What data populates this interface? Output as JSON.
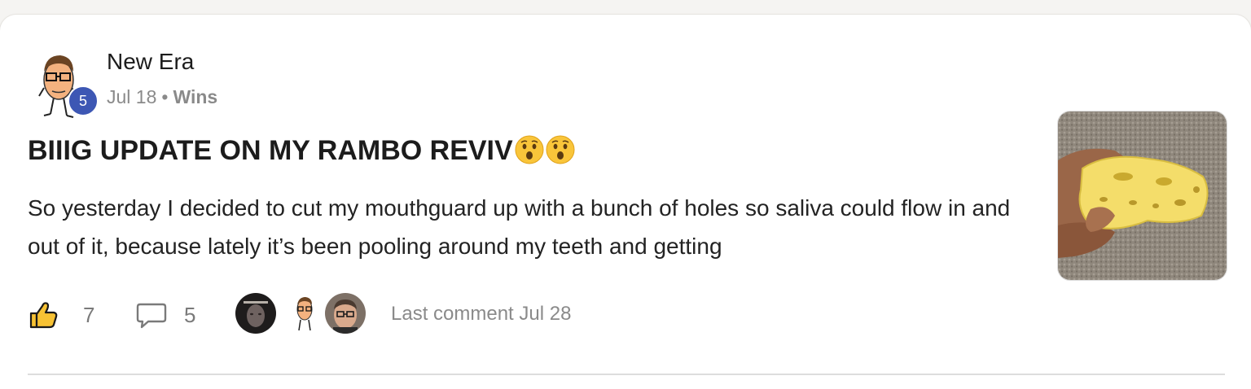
{
  "post": {
    "author": {
      "name": "New Era",
      "level": "5",
      "avatar_icon": "cartoon-man-glasses-avatar"
    },
    "date": "Jul 18",
    "separator": "•",
    "category": "Wins",
    "title": "BIIIG UPDATE ON MY RAMBO REVIV",
    "title_emojis": [
      "hushed-face-emoji",
      "hushed-face-emoji"
    ],
    "body": "So yesterday I decided to cut my mouthguard up with a bunch of holes so saliva could flow in and out of it, because lately it’s been pooling around my teeth and getting",
    "thumbnail_icon": "yellow-mouthguard-photo",
    "likes": "7",
    "comments": "5",
    "commenter_avatars": [
      "dark-selfie-avatar",
      "cartoon-man-glasses-avatar",
      "man-glasses-avatar"
    ],
    "last_comment": "Last comment Jul 28"
  },
  "colors": {
    "badge": "#3d57b4",
    "muted_text": "#8a8a8a",
    "text": "#1c1c1c"
  }
}
